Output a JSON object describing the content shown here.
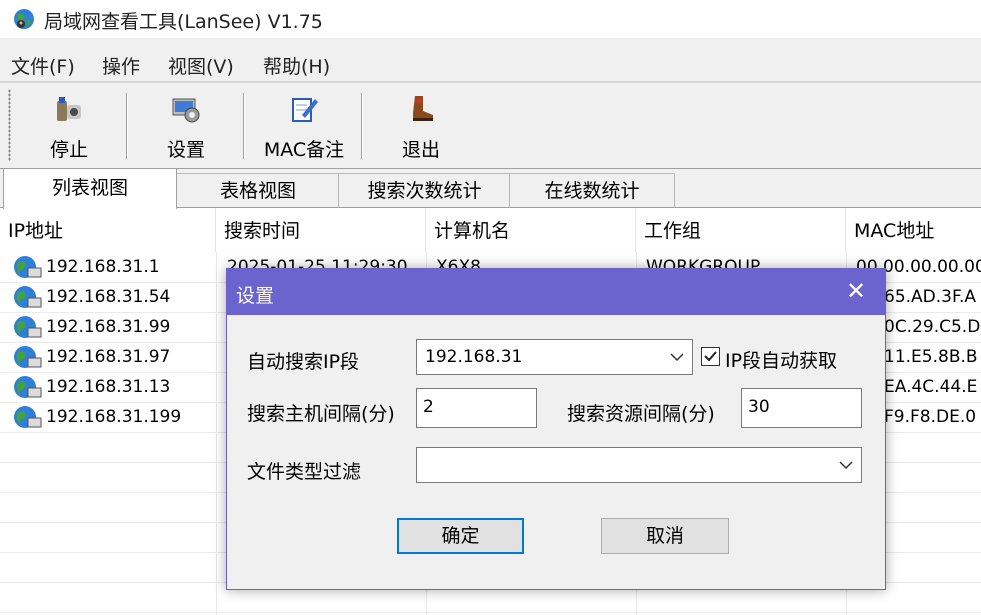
{
  "window": {
    "title": "局域网查看工具(LanSee) V1.75"
  },
  "menu": [
    "文件(F)",
    "操作",
    "视图(V)",
    "帮助(H)"
  ],
  "toolbar": {
    "stop": "停止",
    "settings": "设置",
    "mac_note": "MAC备注",
    "exit": "退出"
  },
  "tabs": [
    "列表视图",
    "表格视图",
    "搜索次数统计",
    "在线数统计"
  ],
  "columns": [
    "IP地址",
    "搜索时间",
    "计算机名",
    "工作组",
    "MAC地址"
  ],
  "rows": [
    {
      "ip": "192.168.31.1",
      "time": "2025-01-25 11:29:30",
      "name": "X6X8",
      "group": "WORKGROUP",
      "mac": "00.00.00.00.00"
    },
    {
      "ip": "192.168.31.54",
      "mac": "65.AD.3F.A"
    },
    {
      "ip": "192.168.31.99",
      "mac": "0C.29.C5.D"
    },
    {
      "ip": "192.168.31.97",
      "mac": "11.E5.8B.B"
    },
    {
      "ip": "192.168.31.13",
      "mac": "EA.4C.44.E"
    },
    {
      "ip": "192.168.31.199",
      "mac": "F9.F8.DE.0"
    }
  ],
  "dialog": {
    "title": "设置",
    "auto_ip_label": "自动搜索IP段",
    "auto_ip_value": "192.168.31",
    "auto_ip_checkbox": "IP段自动获取",
    "auto_ip_checked": true,
    "host_interval_label": "搜索主机间隔(分)",
    "host_interval_value": "2",
    "resource_interval_label": "搜索资源间隔(分)",
    "resource_interval_value": "30",
    "filter_label": "文件类型过滤",
    "filter_value": "",
    "ok": "确定",
    "cancel": "取消"
  },
  "colors": {
    "dialog_title_bg": "#6b63ce",
    "default_button_border": "#0078d7"
  }
}
